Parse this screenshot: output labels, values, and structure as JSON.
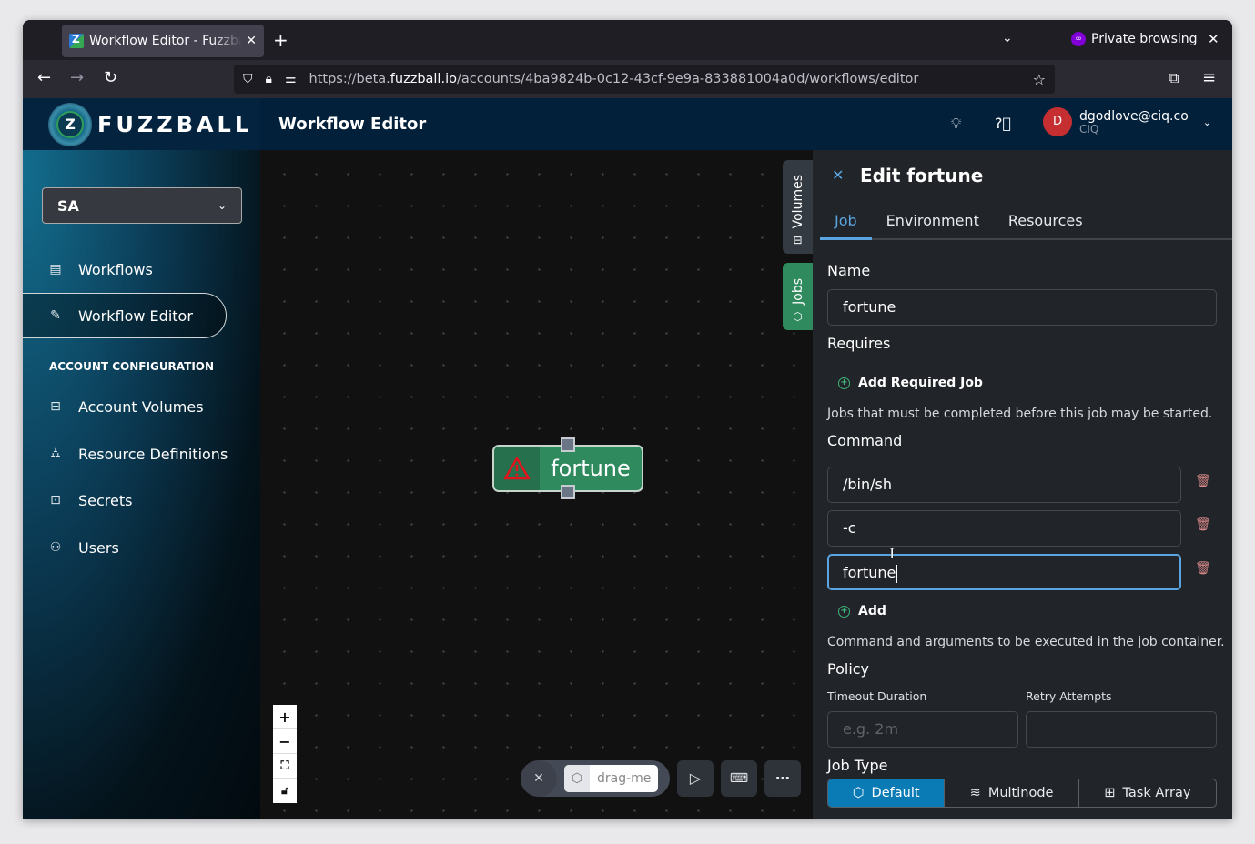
{
  "browser": {
    "tab_title": "Workflow Editor - Fuzzball",
    "new_tab_icon": "plus-icon",
    "private_label": "Private browsing",
    "url_prefix": "https://beta.",
    "url_domain": "fuzzball.io",
    "url_path": "/accounts/4ba9824b-0c12-43cf-9e9a-833881004a0d/workflows/editor"
  },
  "app": {
    "logo_text": "FUZZBALL",
    "logo_mark": "Z",
    "page_title": "Workflow Editor",
    "account_select": "SA",
    "user": {
      "initial": "D",
      "email": "dgodlove@ciq.co",
      "org": "CIQ",
      "avatar_color": "#c62f32"
    }
  },
  "sidebar": {
    "items": [
      {
        "label": "Workflows",
        "icon": "list-icon"
      },
      {
        "label": "Workflow Editor",
        "icon": "edit-icon",
        "active": true
      }
    ],
    "section_title": "ACCOUNT CONFIGURATION",
    "config_items": [
      {
        "label": "Account Volumes",
        "icon": "drive-icon"
      },
      {
        "label": "Resource Definitions",
        "icon": "hierarchy-icon"
      },
      {
        "label": "Secrets",
        "icon": "secret-icon"
      },
      {
        "label": "Users",
        "icon": "users-icon"
      }
    ]
  },
  "canvas": {
    "node_label": "fortune",
    "node_status": "warning",
    "side_tabs": [
      "Volumes",
      "Jobs"
    ],
    "zoom_controls": [
      "+",
      "−",
      "⛶",
      "🔓"
    ],
    "drag_item": "drag-me"
  },
  "panel": {
    "title": "Edit fortune",
    "tabs": [
      "Job",
      "Environment",
      "Resources"
    ],
    "active_tab": "Job",
    "name_label": "Name",
    "name_value": "fortune",
    "requires_label": "Requires",
    "add_required_job": "Add Required Job",
    "requires_help": "Jobs that must be completed before this job may be started.",
    "command_label": "Command",
    "command_args": [
      "/bin/sh",
      "-c",
      "fortune"
    ],
    "add_label": "Add",
    "command_help": "Command and arguments to be executed in the job container.",
    "policy_label": "Policy",
    "timeout_label": "Timeout Duration",
    "timeout_placeholder": "e.g. 2m",
    "retry_label": "Retry Attempts",
    "retry_value": "",
    "job_type_label": "Job Type",
    "job_types": [
      "Default",
      "Multinode",
      "Task Array"
    ],
    "job_type_selected": "Default"
  },
  "colors": {
    "accent": "#5aa5e0",
    "node_green": "#2f8a5e",
    "selected_segment": "#0b7bb6",
    "trash": "#d98a8a"
  }
}
